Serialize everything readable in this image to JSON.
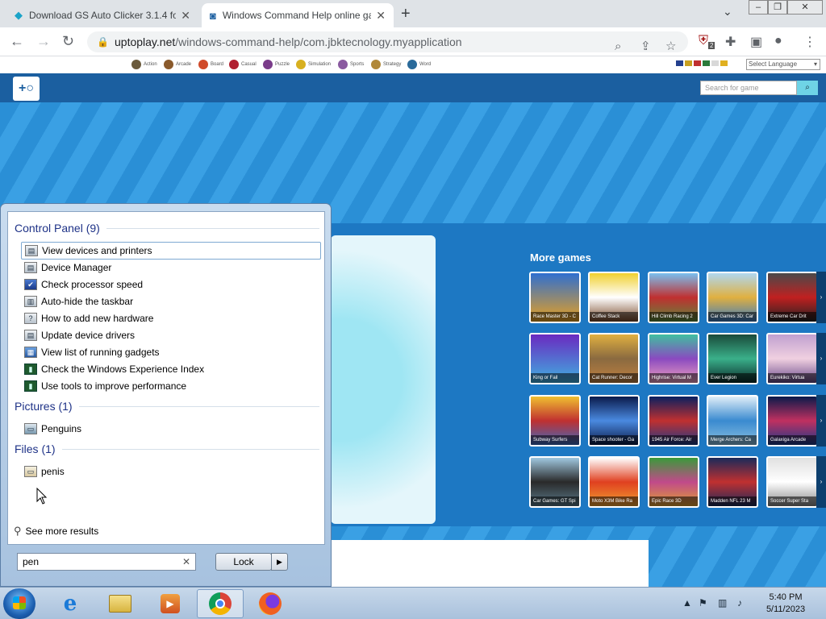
{
  "browser": {
    "tabs": [
      {
        "title": "Download GS Auto Clicker 3.1.4 for",
        "active": false
      },
      {
        "title": "Windows Command Help online gar",
        "active": true
      }
    ],
    "url_host": "uptoplay.net",
    "url_path": "/windows-command-help/com.jbktecnology.myapplication",
    "extension_badge": "2"
  },
  "site": {
    "categories": [
      "Action",
      "Arcade",
      "Board",
      "Casual",
      "Puzzle",
      "Simulation",
      "Sports",
      "Strategy",
      "Word"
    ],
    "language_select": "Select Language",
    "search_placeholder": "Search for game",
    "more_games_title": "More games",
    "games": [
      [
        "Race Master 3D - C",
        "Coffee Stack",
        "Hill Climb Racing 2",
        "Car Games 3D: Car",
        "Extreme Car Drit"
      ],
      [
        "King or Fail",
        "Cat Runner: Decor",
        "Highrise: Virtual M",
        "Ever Legion",
        "Eurekiko: Virtua"
      ],
      [
        "Subway Surfers",
        "Space shooter - Ga",
        "1945 Air Force: Air",
        "Merge Archers: Ca",
        "Galaxiga Arcade"
      ],
      [
        "Car Games: GT Spi",
        "Moto X3M Bike Ra",
        "Epic Race 3D",
        "Madden NFL 23 M",
        "Soccer Super Sta"
      ]
    ]
  },
  "start_menu": {
    "control_panel_header": "Control Panel (9)",
    "control_panel_items": [
      "View devices and printers",
      "Device Manager",
      "Check processor speed",
      "Auto-hide the taskbar",
      "How to add new hardware",
      "Update device drivers",
      "View list of running gadgets",
      "Check the Windows Experience Index",
      "Use tools to improve performance"
    ],
    "pictures_header": "Pictures (1)",
    "pictures_items": [
      "Penguins"
    ],
    "files_header": "Files (1)",
    "files_items": [
      "penis"
    ],
    "see_more": "See more results",
    "search_value": "pen",
    "lock_label": "Lock"
  },
  "taskbar": {
    "time": "5:40 PM",
    "date": "5/11/2023"
  }
}
